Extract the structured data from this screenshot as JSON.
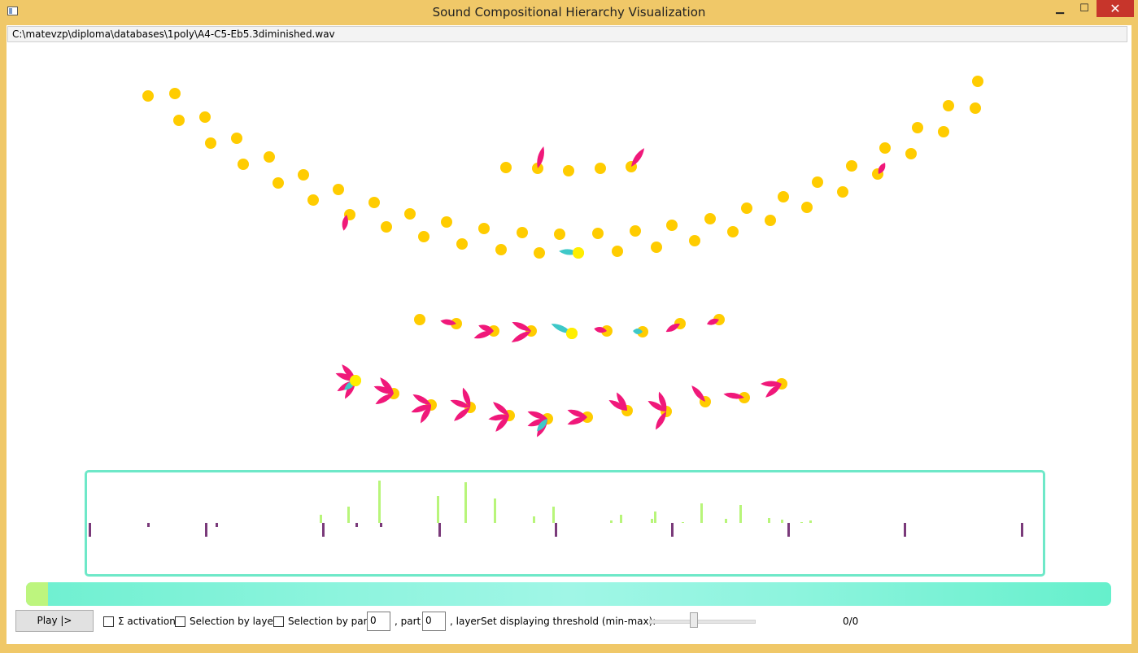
{
  "window": {
    "title": "Sound Compositional Hierarchy Visualization",
    "minimize_glyph": "▁",
    "maximize_glyph": "☐",
    "close_glyph": "✕"
  },
  "file": {
    "path": "C:\\matevzp\\diploma\\databases\\1poly\\A4-C5-Eb5.3diminished.wav"
  },
  "colors": {
    "node": "#ffcc00",
    "node_highlight": "#ffee00",
    "petal": "#f0187a",
    "petal_alt": "#3ec8c8",
    "activation_up": "#b8f57a",
    "activation_down": "#7a3a7a",
    "panel_border": "#6ee8c8"
  },
  "timeline": {
    "progress": 0.02
  },
  "controls": {
    "play_label": "Play |>",
    "sum_activations_label": "Σ activations",
    "selection_by_layer_label": "Selection by layer",
    "selection_by_part_label": "Selection by part",
    "part_value": "0",
    "part_label": ", part",
    "layer_value": "0",
    "layer_label": ", layer",
    "threshold_label": "Set displaying threshold (min-max):",
    "threshold_value": 0.5,
    "threshold_readout": "0/0"
  }
}
